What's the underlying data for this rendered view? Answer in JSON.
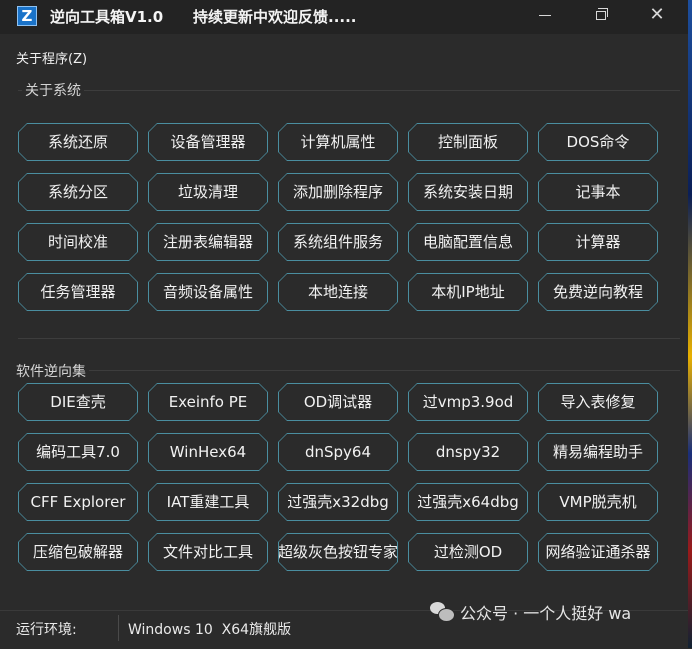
{
  "titlebar": {
    "icon_glyph": "Z",
    "title": "逆向工具箱V1.0",
    "subtitle": "持续更新中欢迎反馈.....",
    "minimize": "minimize",
    "maximize": "restore",
    "close": "✕"
  },
  "menubar": {
    "about": "关于程序(Z)"
  },
  "system_group": {
    "label": "关于系统",
    "buttons": [
      "系统还原",
      "设备管理器",
      "计算机属性",
      "控制面板",
      "DOS命令",
      "系统分区",
      "垃圾清理",
      "添加删除程序",
      "系统安装日期",
      "记事本",
      "时间校准",
      "注册表编辑器",
      "系统组件服务",
      "电脑配置信息",
      "计算器",
      "任务管理器",
      "音频设备属性",
      "本地连接",
      "本机IP地址",
      "免费逆向教程"
    ]
  },
  "tools_group": {
    "label": "软件逆向集",
    "buttons": [
      "DIE查壳",
      "Exeinfo PE",
      "OD调试器",
      "过vmp3.9od",
      "导入表修复",
      "编码工具7.0",
      "WinHex64",
      "dnSpy64",
      "dnspy32",
      "精易编程助手",
      "CFF Explorer",
      "IAT重建工具",
      "过强壳x32dbg",
      "过强壳x64dbg",
      "VMP脱壳机",
      "压缩包破解器",
      "文件对比工具",
      "超级灰色按钮专家",
      "过检测OD",
      "网络验证通杀器"
    ]
  },
  "statusbar": {
    "label": "运行环境:",
    "value": "Windows 10  X64旗舰版"
  },
  "watermark": {
    "text": "公众号 · 一个人挺好 wa"
  },
  "colors": {
    "background": "#2b2b2b",
    "button_border": "#4a8ea0",
    "text": "#f2f2f2"
  }
}
